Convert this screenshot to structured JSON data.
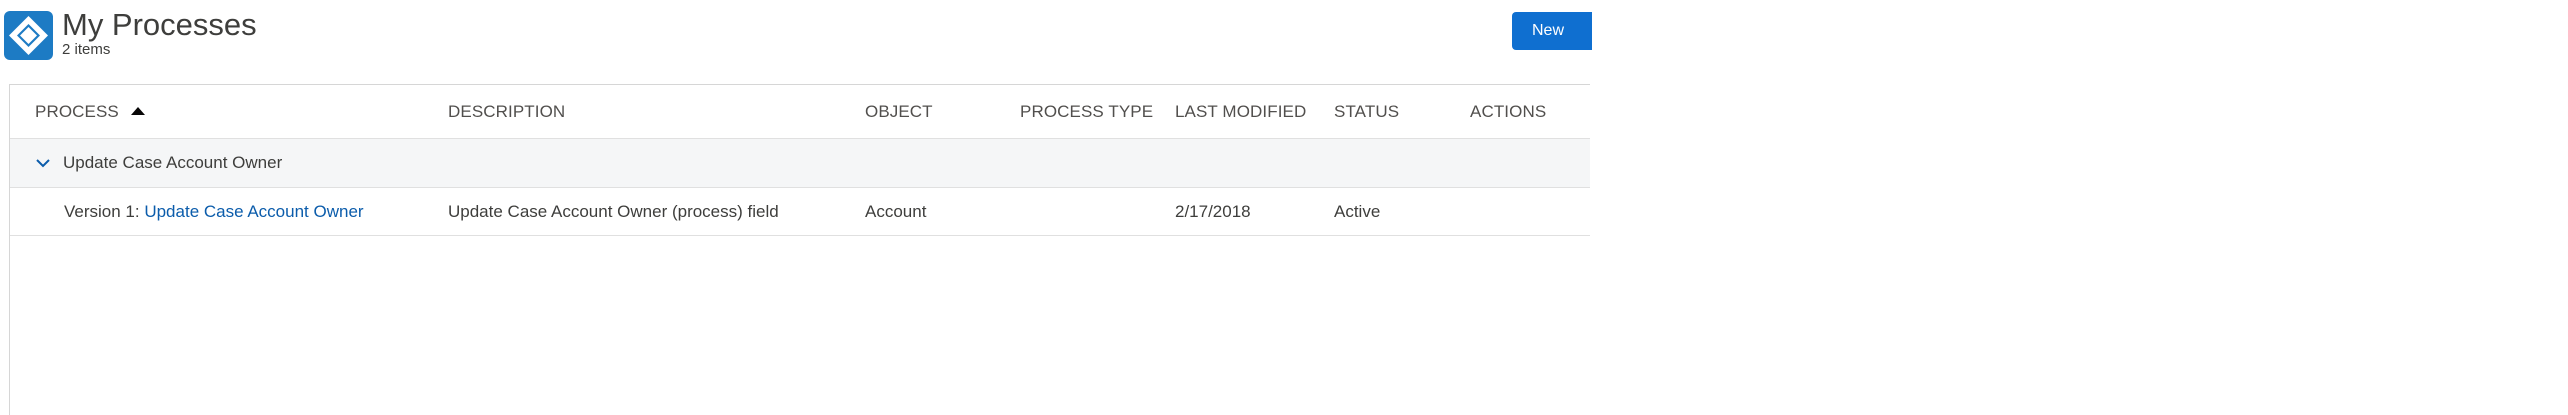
{
  "header": {
    "title": "My Processes",
    "item_count": "2 items",
    "new_button_label": "New",
    "app_icon": "process-diamond-icon",
    "app_icon_color": "#1d7bc4",
    "button_color": "#0f6fd0"
  },
  "table": {
    "columns": {
      "process": "PROCESS",
      "description": "DESCRIPTION",
      "object": "OBJECT",
      "process_type": "PROCESS TYPE",
      "last_modified": "LAST MODIFIED",
      "status": "STATUS",
      "actions": "ACTIONS"
    },
    "sort_icon": "sort-ascending-icon",
    "groups": [
      {
        "name": "Update Case Account Owner",
        "expand_icon": "chevron-down-icon",
        "versions": [
          {
            "version_prefix": "Version 1: ",
            "version_link": "Update Case Account Owner",
            "description": "Update Case Account Owner (process) field",
            "object": "Account",
            "process_type": "",
            "last_modified": "2/17/2018",
            "status": "Active"
          }
        ]
      }
    ],
    "link_color": "#0b5cab"
  }
}
